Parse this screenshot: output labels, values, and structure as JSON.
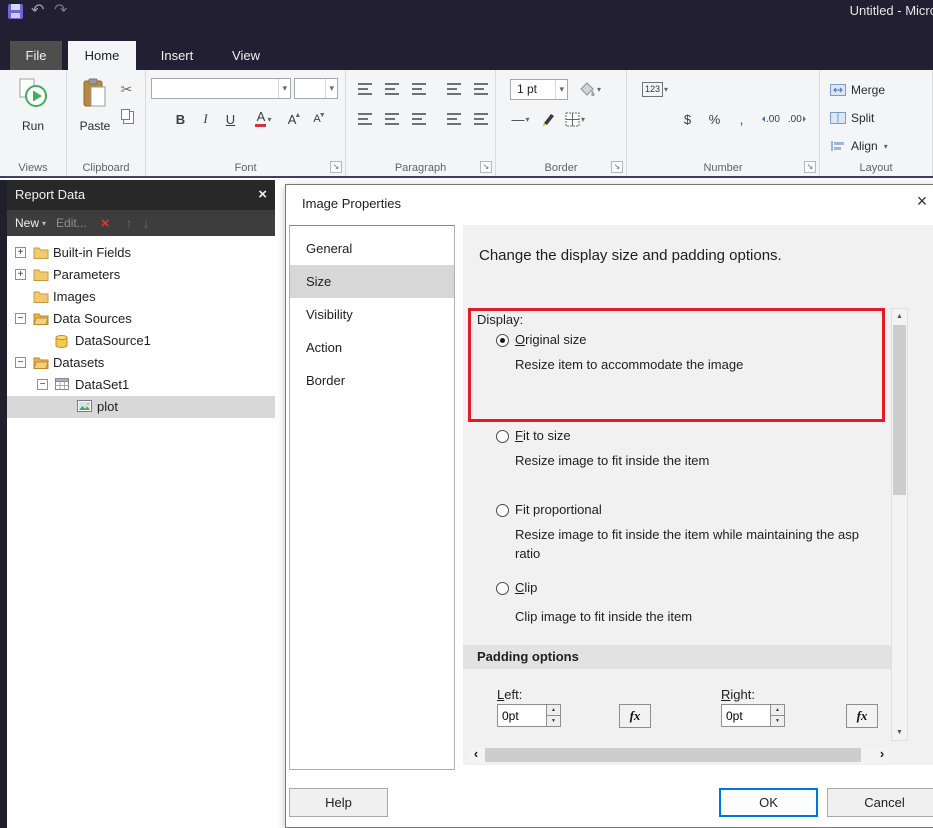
{
  "titlebar": {
    "title": "Untitled - Micro"
  },
  "glyphs": {
    "dropdown": "▾",
    "close": "×",
    "undo": "↶",
    "redo": "↷",
    "cut": "✂",
    "delete_x": "×",
    "up_arrow": "↑",
    "down_arrow": "↓",
    "launcher": "↘",
    "spin_up": "▲",
    "spin_down": "▼",
    "scroll_up": "▲",
    "scroll_down": "▼",
    "scroll_left": "‹",
    "scroll_right": "›",
    "expand": "+",
    "collapse": "−",
    "line": "—"
  },
  "tabs": {
    "file": "File",
    "home": "Home",
    "insert": "Insert",
    "view": "View"
  },
  "ribbon": {
    "views": {
      "label": "Views",
      "run": "Run"
    },
    "clipboard": {
      "label": "Clipboard",
      "paste": "Paste"
    },
    "font": {
      "label": "Font",
      "bold": "B",
      "italic": "I",
      "underline": "U",
      "color_letter": "A",
      "grow_letter": "A",
      "shrink_letter": "A"
    },
    "paragraph": {
      "label": "Paragraph"
    },
    "border": {
      "label": "Border",
      "width_value": "1 pt"
    },
    "number": {
      "label": "Number",
      "format": "123",
      "currency": "$",
      "percent": "%",
      "comma": ",",
      "dec_inc": ".00",
      "dec_dec": ".00"
    },
    "layout": {
      "label": "Layout",
      "merge": "Merge",
      "split": "Split",
      "align": "Align"
    }
  },
  "report_data": {
    "title": "Report Data",
    "new": "New",
    "edit": "Edit...",
    "tree": [
      {
        "label": "Built-in Fields"
      },
      {
        "label": "Parameters"
      },
      {
        "label": "Images"
      },
      {
        "label": "Data Sources"
      },
      {
        "label": "DataSource1"
      },
      {
        "label": "Datasets"
      },
      {
        "label": "DataSet1"
      },
      {
        "label": "plot"
      }
    ]
  },
  "dialog": {
    "title": "Image Properties",
    "nav": [
      {
        "label": "General"
      },
      {
        "label": "Size"
      },
      {
        "label": "Visibility"
      },
      {
        "label": "Action"
      },
      {
        "label": "Border"
      }
    ],
    "heading": "Change the display size and padding options.",
    "display_label": "Display:",
    "options": [
      {
        "label": "Original size",
        "desc": "Resize item to accommodate the image"
      },
      {
        "label": "Fit to size",
        "desc": "Resize image to fit inside the item"
      },
      {
        "label": "Fit proportional",
        "desc": "Resize image to fit inside the item while maintaining the asp\nratio"
      },
      {
        "label": "Clip",
        "desc": "Clip image to fit inside the item"
      }
    ],
    "padding": {
      "header": "Padding options",
      "left_label": "Left:",
      "right_label": "Right:",
      "left_value": "0pt",
      "right_value": "0pt",
      "fx": "fx"
    },
    "help": "Help",
    "ok": "OK",
    "cancel": "Cancel"
  }
}
